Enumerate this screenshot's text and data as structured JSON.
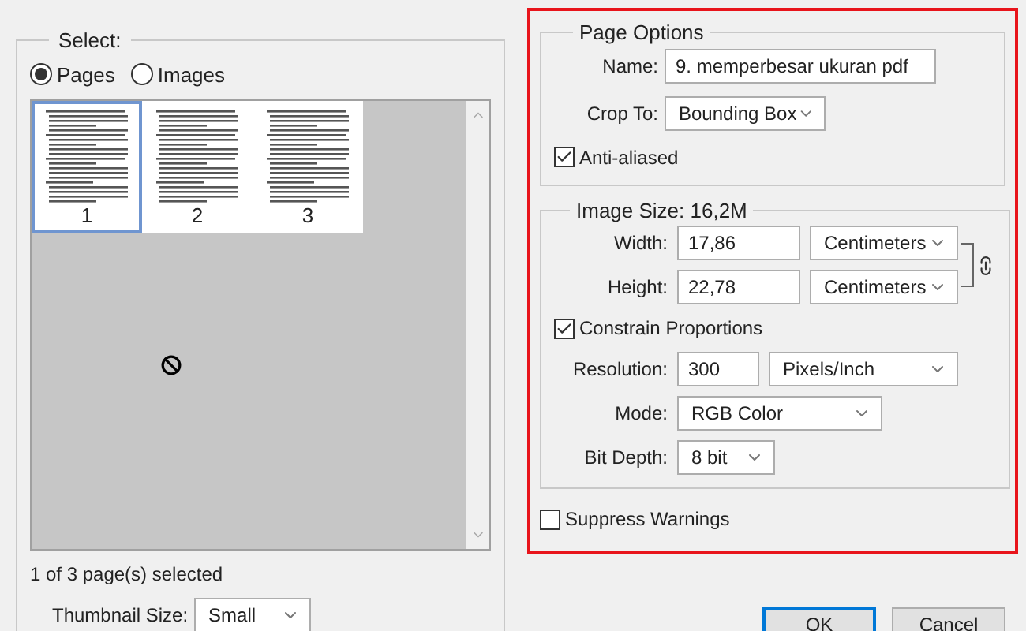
{
  "select": {
    "legend": "Select:",
    "modes": [
      {
        "label": "Pages",
        "selected": true
      },
      {
        "label": "Images",
        "selected": false
      }
    ],
    "pages": [
      {
        "label": "1",
        "selected": true
      },
      {
        "label": "2",
        "selected": false
      },
      {
        "label": "3",
        "selected": false
      }
    ],
    "status": "1 of 3 page(s) selected",
    "thumbnail_size": {
      "label": "Thumbnail Size:",
      "value": "Small"
    }
  },
  "page_options": {
    "legend": "Page Options",
    "name": {
      "label": "Name:",
      "value": "9. memperbesar ukuran pdf"
    },
    "crop_to": {
      "label": "Crop To:",
      "value": "Bounding Box"
    },
    "anti_aliased": {
      "label": "Anti-aliased",
      "checked": true
    }
  },
  "image_size": {
    "legend": "Image Size: 16,2M",
    "width": {
      "label": "Width:",
      "value": "17,86",
      "unit": "Centimeters"
    },
    "height": {
      "label": "Height:",
      "value": "22,78",
      "unit": "Centimeters"
    },
    "constrain": {
      "label": "Constrain Proportions",
      "checked": true
    },
    "resolution": {
      "label": "Resolution:",
      "value": "300",
      "unit": "Pixels/Inch"
    },
    "mode": {
      "label": "Mode:",
      "value": "RGB Color"
    },
    "bit_depth": {
      "label": "Bit Depth:",
      "value": "8 bit"
    }
  },
  "suppress_warnings": {
    "label": "Suppress Warnings",
    "checked": false
  },
  "buttons": [
    {
      "label": "OK",
      "kind": "default"
    },
    {
      "label": "Cancel",
      "kind": "normal"
    }
  ]
}
